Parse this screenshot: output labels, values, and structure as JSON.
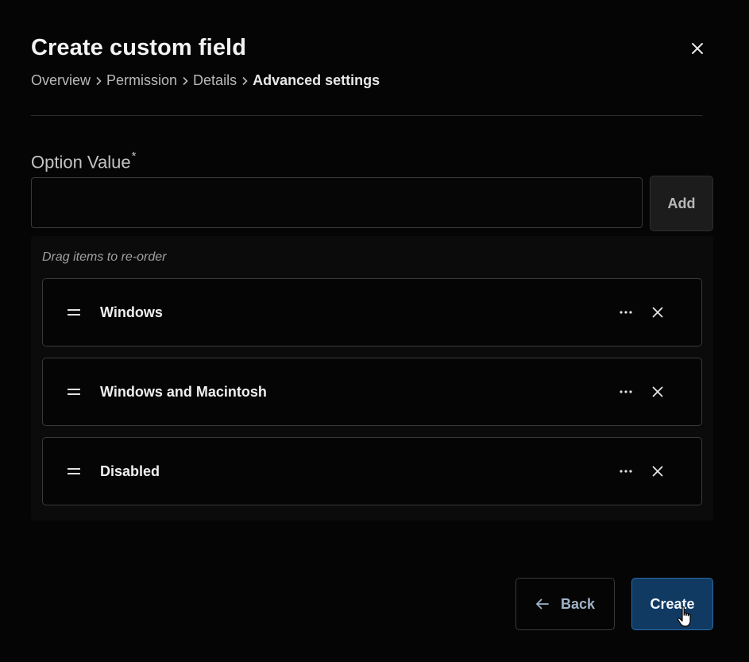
{
  "modal": {
    "title": "Create custom field",
    "breadcrumb": [
      "Overview",
      "Permission",
      "Details",
      "Advanced settings"
    ]
  },
  "option_field": {
    "label": "Option Value",
    "required_marker": "*",
    "value": "",
    "add_label": "Add"
  },
  "list": {
    "hint": "Drag items to re-order",
    "items": [
      {
        "label": "Windows"
      },
      {
        "label": "Windows and Macintosh"
      },
      {
        "label": "Disabled"
      }
    ]
  },
  "footer": {
    "back_label": "Back",
    "create_label": "Create"
  },
  "colors": {
    "background": "#050505",
    "primary_button": "#113a63",
    "primary_border": "#2c6aa5",
    "back_text": "#9fb3c8"
  },
  "icons": {
    "close": "close-icon",
    "breadcrumb_separator": "chevron-right-icon",
    "drag": "drag-handle-icon",
    "more": "more-horizontal-icon",
    "remove": "close-icon",
    "back": "arrow-left-icon",
    "cursor": "hand-pointer-cursor-icon"
  }
}
